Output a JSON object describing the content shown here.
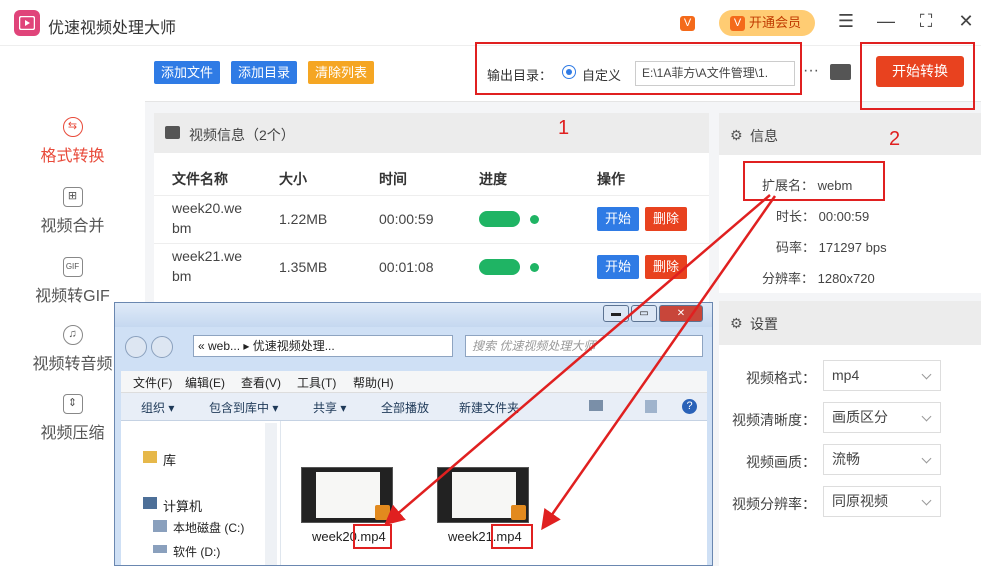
{
  "app": {
    "title": "优速视频处理大师",
    "vip_label": "开通会员",
    "vip_icon_glyph": "V",
    "small_icon_glyph": "V"
  },
  "window_controls": {
    "menu": "☰",
    "minimize": "—",
    "maximize": "⛶",
    "close": "✕"
  },
  "sidebar": {
    "items": [
      {
        "label": "格式转换",
        "icon": "format-convert-icon",
        "active": true
      },
      {
        "label": "视频合并",
        "icon": "merge-icon"
      },
      {
        "label": "视频转GIF",
        "icon": "gif-icon",
        "icon_text": "GIF"
      },
      {
        "label": "视频转音频",
        "icon": "audio-icon"
      },
      {
        "label": "视频压缩",
        "icon": "compress-icon"
      }
    ]
  },
  "toolbar": {
    "add_file": "添加文件",
    "add_dir": "添加目录",
    "clear_list": "清除列表",
    "output_dir_label": "输出目录：",
    "custom_label": "自定义",
    "path": "E:\\1A菲方\\A文件管理\\1.",
    "more": "···",
    "start_all": "开始转换"
  },
  "video_panel": {
    "title": "视频信息（2个）",
    "headers": [
      "文件名称",
      "大小",
      "时间",
      "进度",
      "操作"
    ],
    "rows": [
      {
        "name_line1": "week20.we",
        "name_line2": "bm",
        "size": "1.22MB",
        "time": "00:00:59",
        "start": "开始",
        "delete": "删除"
      },
      {
        "name_line1": "week21.we",
        "name_line2": "bm",
        "size": "1.35MB",
        "time": "00:01:08",
        "start": "开始",
        "delete": "删除"
      }
    ]
  },
  "info_panel": {
    "title": "信息",
    "ext": "扩展名： webm",
    "duration": "时长： 00:00:59",
    "bitrate": "码率： 171297 bps",
    "resolution": "分辨率： 1280x720"
  },
  "settings_panel": {
    "title": "设置",
    "rows": [
      {
        "label": "视频格式：",
        "value": "mp4"
      },
      {
        "label": "视频清晰度：",
        "value": "画质区分"
      },
      {
        "label": "视频画质：",
        "value": "流畅"
      },
      {
        "label": "视频分辨率：",
        "value": "同原视频"
      }
    ]
  },
  "annotations": {
    "one": "1",
    "two": "2"
  },
  "explorer": {
    "address": "«  web...  ▸  优速视频处理...",
    "search_placeholder": "搜索 优速视频处理大师",
    "menus": [
      "文件(F)",
      "编辑(E)",
      "查看(V)",
      "工具(T)",
      "帮助(H)"
    ],
    "tools": [
      "组织 ▾",
      "包含到库中 ▾",
      "共享 ▾",
      "全部播放",
      "新建文件夹"
    ],
    "nav": {
      "library": "库",
      "computer": "计算机",
      "disk_c": "本地磁盘 (C:)",
      "disk_d": "软件 (D:)"
    },
    "files": [
      {
        "name": "week20.mp4"
      },
      {
        "name": "week21.mp4"
      }
    ]
  },
  "colors": {
    "accent_red": "#e8421f",
    "blue_button": "#2f7be5",
    "orange_button": "#f5a623",
    "progress_green": "#1fb464",
    "annotation_red": "#e02020"
  }
}
